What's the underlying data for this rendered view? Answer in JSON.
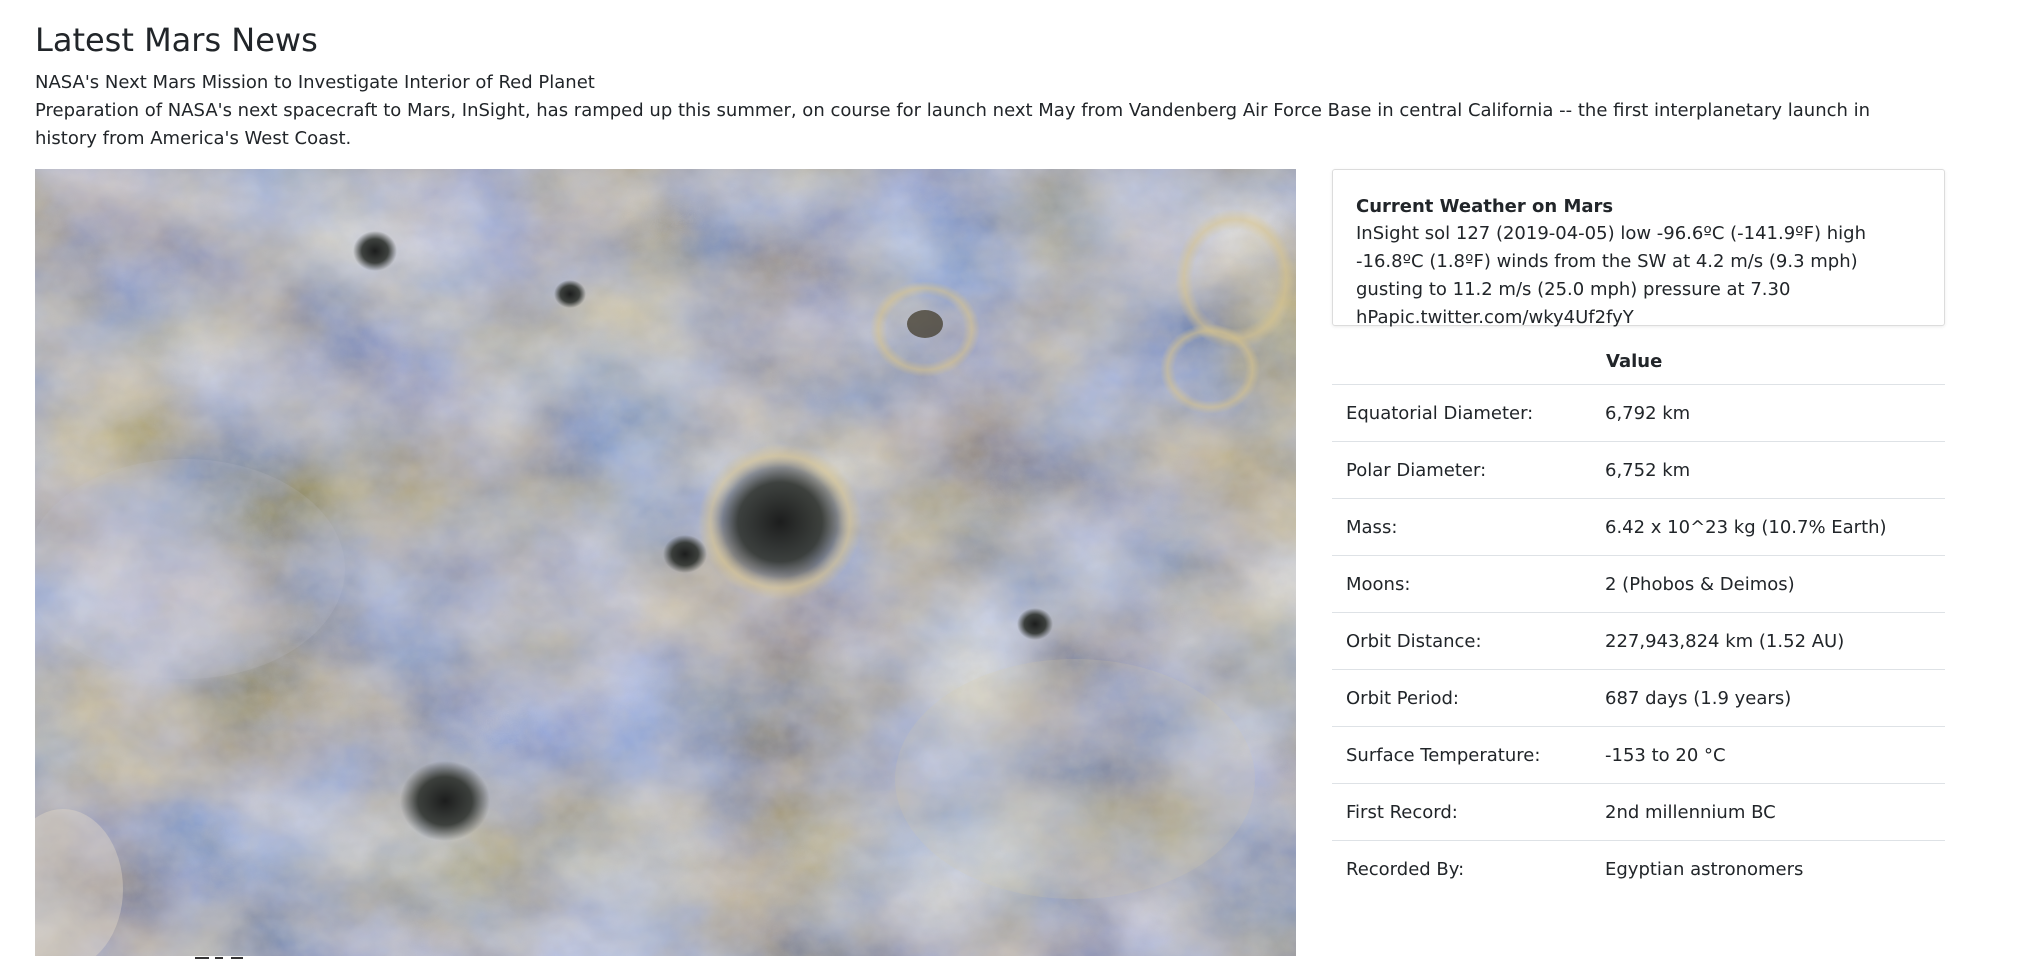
{
  "news": {
    "section_title": "Latest Mars News",
    "headline": "NASA's Next Mars Mission to Investigate Interior of Red Planet",
    "teaser": "Preparation of NASA's next spacecraft to Mars, InSight, has ramped up this summer, on course for launch next May from Vandenberg Air Force Base in central California -- the first interplanetary launch in history from America's West Coast."
  },
  "weather": {
    "title": "Current Weather on Mars",
    "text": "InSight sol 127 (2019-04-05) low -96.6ºC (-141.9ºF) high -16.8ºC (1.8ºF) winds from the SW at 4.2 m/s (9.3 mph) gusting to 11.2 m/s (25.0 mph) pressure at 7.30 hPapic.twitter.com/wky4Uf2fyY"
  },
  "facts": {
    "headers": [
      "",
      "Value"
    ],
    "rows": [
      {
        "label": "Equatorial Diameter:",
        "value": "6,792 km"
      },
      {
        "label": "Polar Diameter:",
        "value": "6,752 km"
      },
      {
        "label": "Mass:",
        "value": "6.42 x 10^23 kg (10.7% Earth)"
      },
      {
        "label": "Moons:",
        "value": "2 (Phobos & Deimos)"
      },
      {
        "label": "Orbit Distance:",
        "value": "227,943,824 km (1.52 AU)"
      },
      {
        "label": "Orbit Period:",
        "value": "687 days (1.9 years)"
      },
      {
        "label": "Surface Temperature:",
        "value": "-153 to 20 °C"
      },
      {
        "label": "First Record:",
        "value": "2nd millennium BC"
      },
      {
        "label": "Recorded By:",
        "value": "Egyptian astronomers"
      }
    ]
  },
  "colors": {
    "text": "#212529",
    "border": "#dee2e6"
  }
}
